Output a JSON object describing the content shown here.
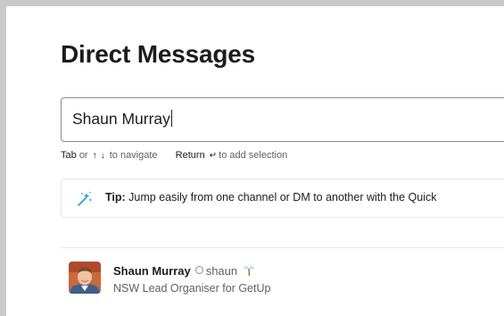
{
  "page": {
    "title": "Direct Messages"
  },
  "search": {
    "value": "Shaun Murray"
  },
  "hint": {
    "tab_key": "Tab",
    "or": "or",
    "up_arrow": "↑",
    "down_arrow": "↓",
    "navigate": "to navigate",
    "return_key": "Return",
    "return_icon": "↵",
    "add_selection": "to add selection"
  },
  "tip": {
    "icon": "sparkle-wand-icon",
    "label": "Tip:",
    "text": "Jump easily from one channel or DM to another with the Quick"
  },
  "results": [
    {
      "name": "Shaun Murray",
      "username": "shaun",
      "presence": "away",
      "status_icon": "palm-tree-icon",
      "title": "NSW Lead Organiser for GetUp"
    }
  ],
  "colors": {
    "text_primary": "#1d1c1d",
    "text_secondary": "#616061",
    "border": "#8c8c8c",
    "tip_icon": "#1d9bd1",
    "status_icon": "#2eb67d",
    "outer_frame": "#c9c9c9"
  }
}
